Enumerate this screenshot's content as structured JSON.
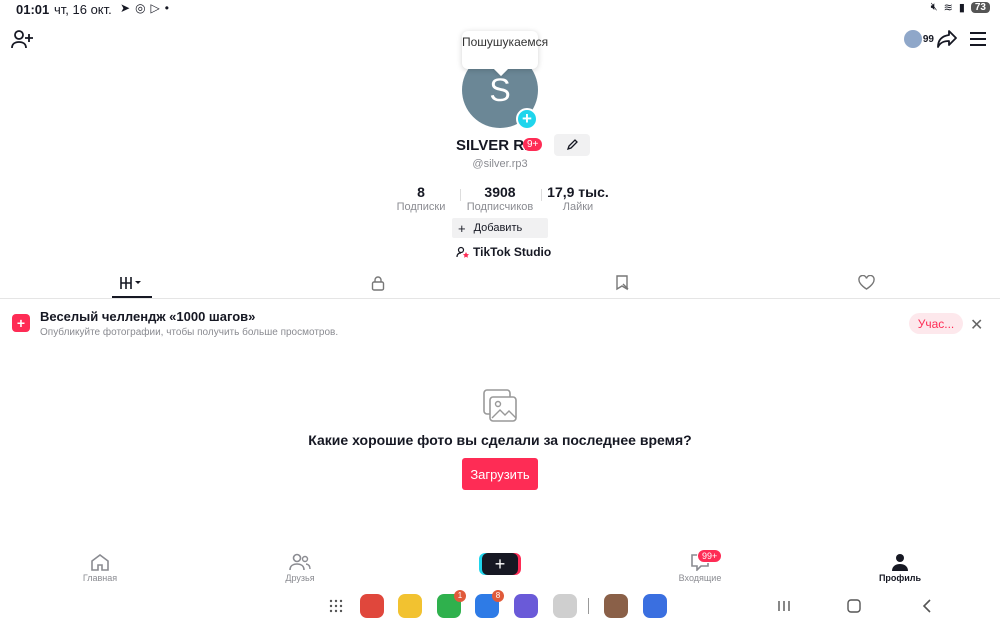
{
  "status_bar": {
    "time": "01:01",
    "date": "чт, 16 окт.",
    "battery": "73"
  },
  "profile": {
    "tooltip": "Пошушукаемся",
    "avatar_letter": "S",
    "username": "SILVER RP",
    "badge": "9+",
    "handle": "@silver.rp3",
    "followers_count_top": "99",
    "stats": [
      {
        "value": "8",
        "label": "Подписки"
      },
      {
        "value": "3908",
        "label": "Подписчиков"
      },
      {
        "value": "17,9 тыс.",
        "label": "Лайки"
      }
    ],
    "add_button": "Добавить",
    "studio_link": "TikTok Studio"
  },
  "challenge": {
    "title": "Веселый челлендж «1000 шагов»",
    "subtitle": "Опубликуйте фотографии, чтобы получить больше просмотров.",
    "join_label": "Учас..."
  },
  "empty_state": {
    "prompt": "Какие хорошие фото вы сделали за последнее время?",
    "upload_label": "Загрузить"
  },
  "bottom_nav": {
    "home": "Главная",
    "friends": "Друзья",
    "inbox": "Входящие",
    "inbox_badge": "99+",
    "profile": "Профиль"
  },
  "dock": {
    "phone_badge": "1",
    "messages_badge": "8"
  },
  "colors": {
    "accent": "#fe2c55",
    "cyan": "#20d5ec",
    "avatar_bg": "#6b8796"
  }
}
